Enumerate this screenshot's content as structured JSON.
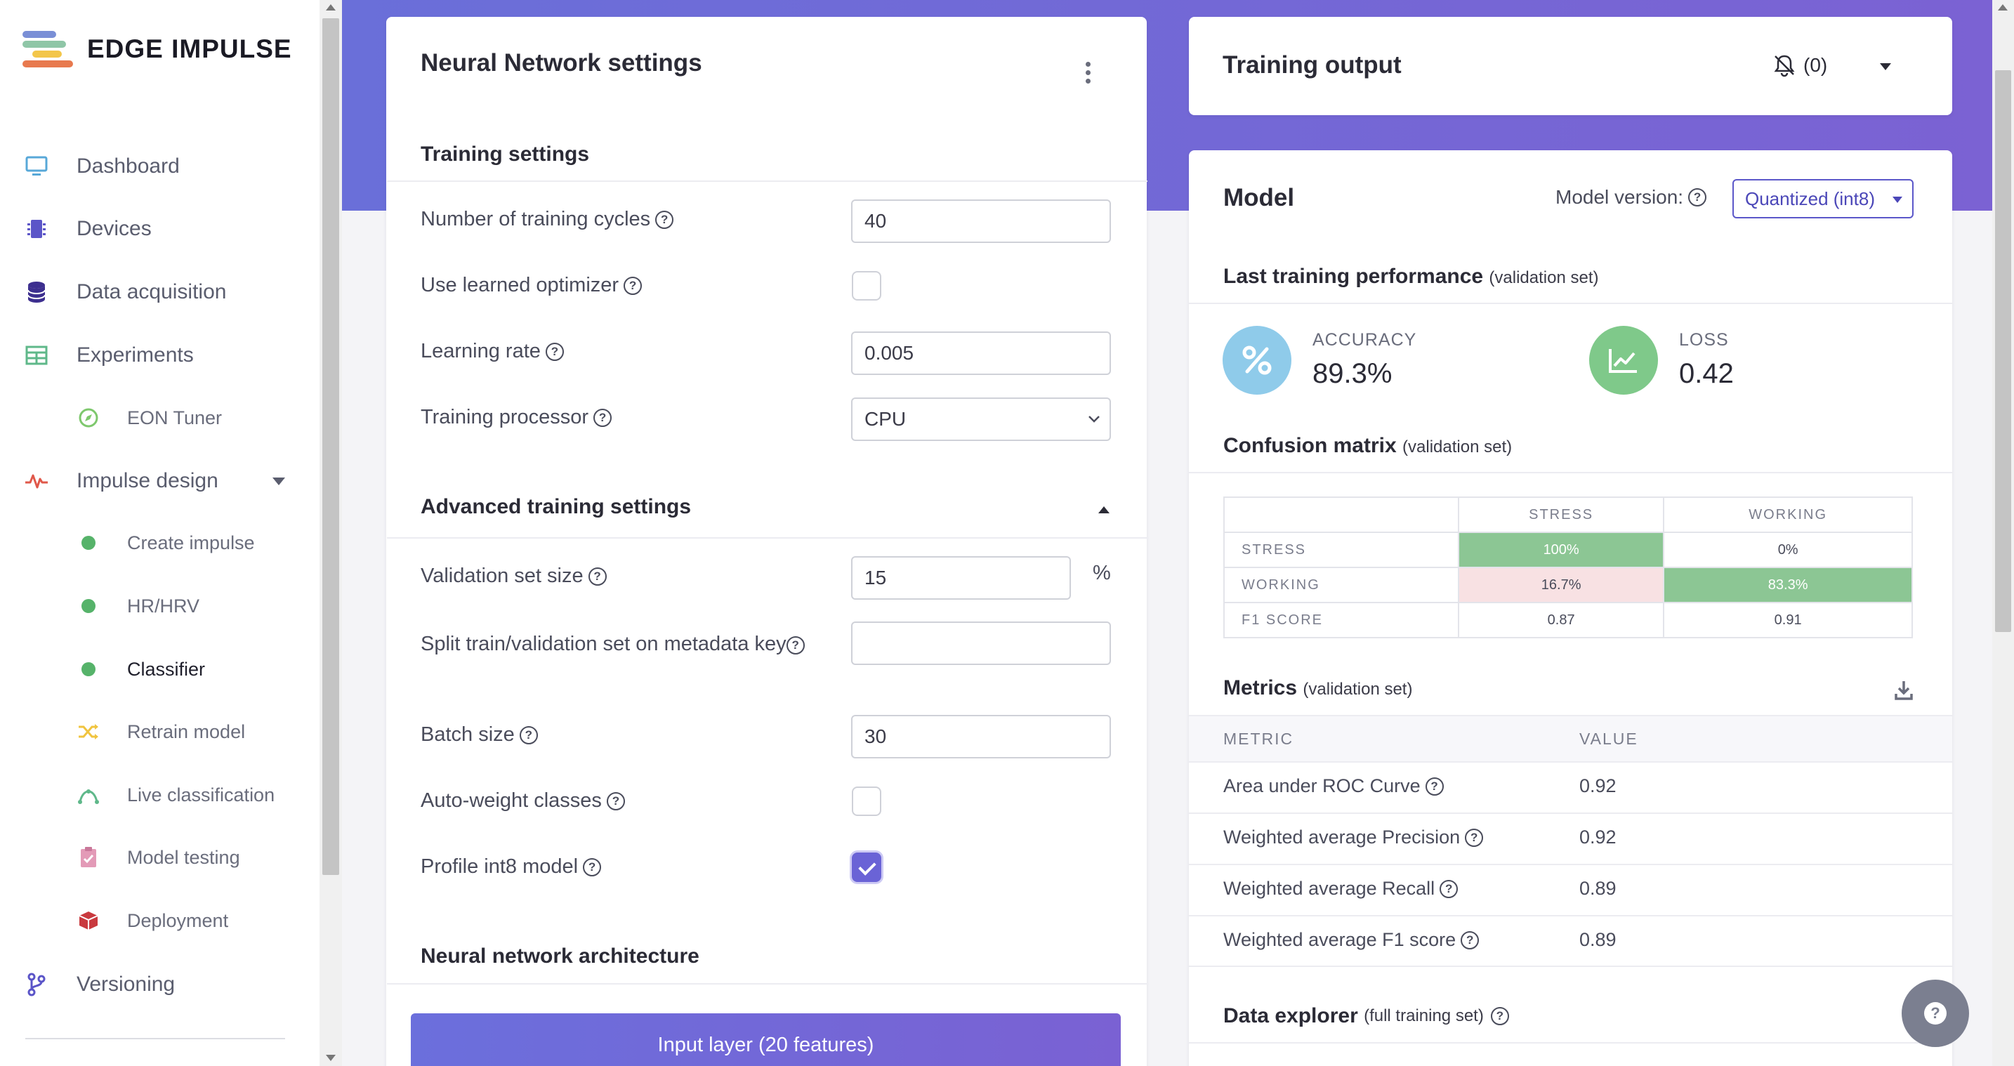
{
  "brand": {
    "name": "EDGE IMPULSE"
  },
  "sidebar": {
    "items": [
      {
        "label": "Dashboard",
        "icon": "monitor-icon"
      },
      {
        "label": "Devices",
        "icon": "chip-icon"
      },
      {
        "label": "Data acquisition",
        "icon": "database-icon"
      },
      {
        "label": "Experiments",
        "icon": "table-icon"
      },
      {
        "label": "EON Tuner",
        "icon": "compass-icon"
      },
      {
        "label": "Impulse design",
        "icon": "pulse-icon"
      },
      {
        "label": "Create impulse",
        "icon": "status-dot-icon"
      },
      {
        "label": "HR/HRV",
        "icon": "status-dot-icon"
      },
      {
        "label": "Classifier",
        "icon": "status-dot-icon"
      },
      {
        "label": "Retrain model",
        "icon": "shuffle-icon"
      },
      {
        "label": "Live classification",
        "icon": "curve-icon"
      },
      {
        "label": "Model testing",
        "icon": "clipboard-check-icon"
      },
      {
        "label": "Deployment",
        "icon": "cube-icon"
      },
      {
        "label": "Versioning",
        "icon": "git-branch-icon"
      }
    ]
  },
  "nn": {
    "title": "Neural Network settings",
    "training_settings_title": "Training settings",
    "cycles_label": "Number of training cycles",
    "cycles_value": "40",
    "learned_optimizer_label": "Use learned optimizer",
    "learned_optimizer_checked": false,
    "learning_rate_label": "Learning rate",
    "learning_rate_value": "0.005",
    "processor_label": "Training processor",
    "processor_value": "CPU",
    "advanced_title": "Advanced training settings",
    "validation_label": "Validation set size",
    "validation_value": "15",
    "validation_unit": "%",
    "split_label": "Split train/validation set on metadata key",
    "split_value": "",
    "batch_label": "Batch size",
    "batch_value": "30",
    "autoweight_label": "Auto-weight classes",
    "autoweight_checked": false,
    "profile_label": "Profile int8 model",
    "profile_checked": true,
    "architecture_title": "Neural network architecture",
    "input_layer_label": "Input layer (20 features)"
  },
  "training_output": {
    "title": "Training output",
    "notifications": "(0)"
  },
  "model": {
    "title": "Model",
    "version_label": "Model version:",
    "version_value": "Quantized (int8)",
    "perf_title": "Last training performance",
    "perf_note": "(validation set)",
    "accuracy_label": "ACCURACY",
    "accuracy_value": "89.3%",
    "loss_label": "LOSS",
    "loss_value": "0.42",
    "cm_title": "Confusion matrix",
    "cm_note": "(validation set)",
    "cm_columns": [
      "STRESS",
      "WORKING"
    ],
    "cm_rows": [
      {
        "label": "STRESS",
        "cells": [
          "100%",
          "0%"
        ]
      },
      {
        "label": "WORKING",
        "cells": [
          "16.7%",
          "83.3%"
        ]
      },
      {
        "label": "F1 SCORE",
        "cells": [
          "0.87",
          "0.91"
        ]
      }
    ],
    "metrics_title": "Metrics",
    "metrics_note": "(validation set)",
    "metrics_headers": [
      "METRIC",
      "VALUE"
    ],
    "metrics": [
      {
        "name": "Area under ROC Curve",
        "value": "0.92"
      },
      {
        "name": "Weighted average Precision",
        "value": "0.92"
      },
      {
        "name": "Weighted average Recall",
        "value": "0.89"
      },
      {
        "name": "Weighted average F1 score",
        "value": "0.89"
      }
    ],
    "explorer_title": "Data explorer",
    "explorer_note": "(full training set)"
  },
  "colors": {
    "accent": "#6a63d6",
    "band_start": "#6a6fd9",
    "band_end": "#7b62d3",
    "cm_green": "#8cc694",
    "cm_pink": "#f8e1e3",
    "accuracy_circle": "#8fcbea",
    "loss_circle": "#7fc98a"
  }
}
